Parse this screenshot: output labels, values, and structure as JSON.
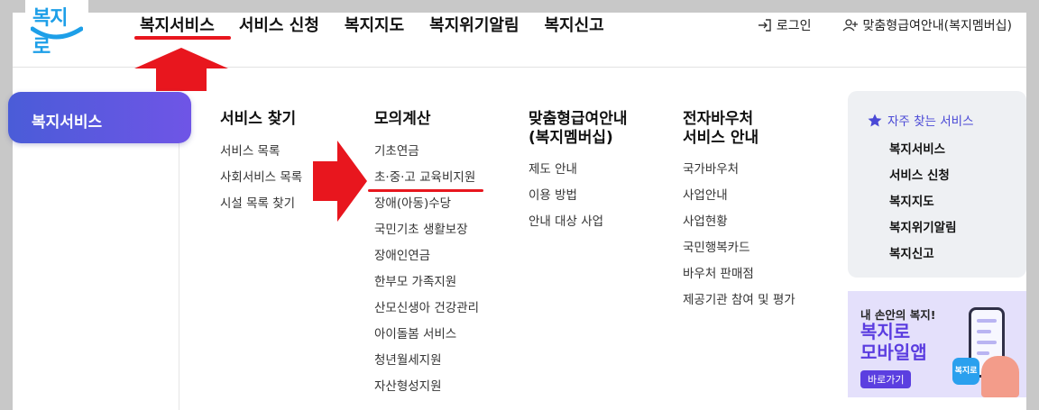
{
  "logo": {
    "text": "복지로"
  },
  "gnb": {
    "items": [
      "복지서비스",
      "서비스 신청",
      "복지지도",
      "복지위기알림",
      "복지신고"
    ]
  },
  "util": {
    "login": "로그인",
    "custom": "맞춤형급여안내(복지멤버십)"
  },
  "side": {
    "active": "복지서비스"
  },
  "columns": [
    {
      "title": "서비스 찾기",
      "links": [
        "서비스 목록",
        "사회서비스 목록",
        "시설 목록 찾기"
      ]
    },
    {
      "title": "모의계산",
      "links": [
        "기초연금",
        "초·중·고 교육비지원",
        "장애(아동)수당",
        "국민기초 생활보장",
        "장애인연금",
        "한부모 가족지원",
        "산모신생아 건강관리",
        "아이돌봄 서비스",
        "청년월세지원",
        "자산형성지원"
      ]
    },
    {
      "title_line1": "맞춤형급여안내",
      "title_line2": "(복지멤버십)",
      "links": [
        "제도 안내",
        "이용 방법",
        "안내 대상 사업"
      ]
    },
    {
      "title_line1": "전자바우처",
      "title_line2": "서비스 안내",
      "links": [
        "국가바우처",
        "사업안내",
        "사업현황",
        "국민행복카드",
        "바우처 판매점",
        "제공기관 참여 및 평가"
      ]
    }
  ],
  "quick": {
    "title": "자주 찾는 서비스",
    "links": [
      "복지서비스",
      "서비스 신청",
      "복지지도",
      "복지위기알림",
      "복지신고"
    ]
  },
  "banner": {
    "line1": "내 손안의 복지!",
    "line2a": "복지로",
    "line2b": "모바일앱",
    "button": "바로가기",
    "icon_text": "복지로"
  },
  "colors": {
    "accent": "#4a49d6",
    "annotation": "#e8161e",
    "logo": "#1d9fe8"
  }
}
